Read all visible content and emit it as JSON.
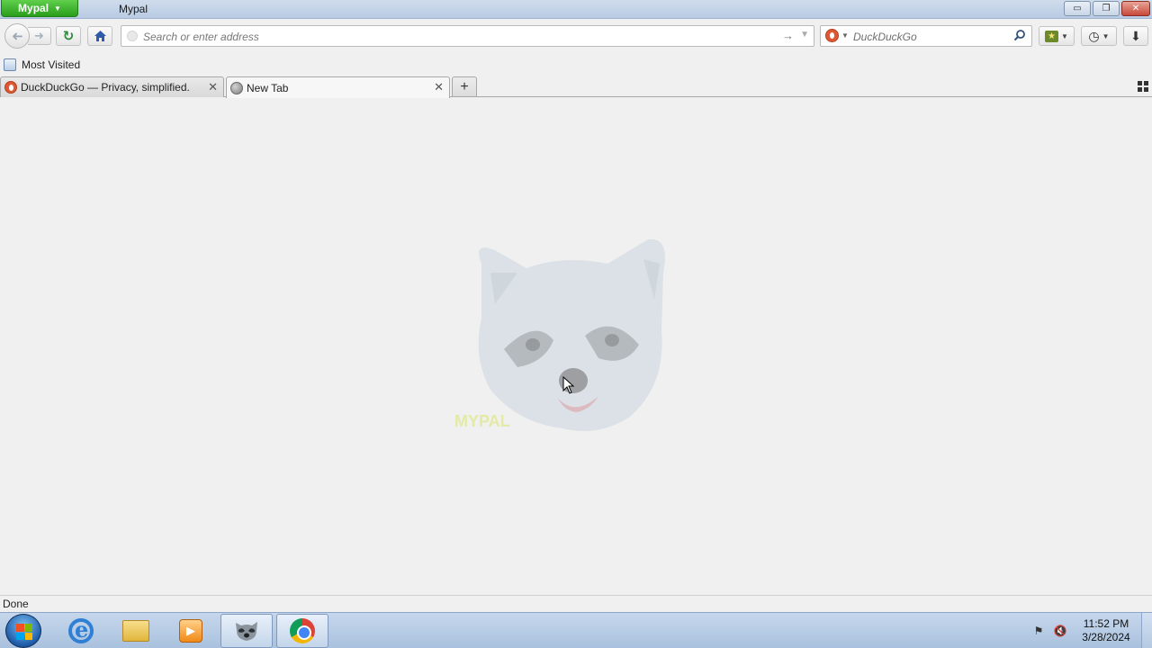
{
  "window": {
    "app_menu_label": "Mypal",
    "title": "Mypal",
    "controls": {
      "minimize": "▭",
      "restore": "❐",
      "close": "✕"
    }
  },
  "navbar": {
    "url_placeholder": "Search or enter address",
    "search_placeholder": "DuckDuckGo",
    "icons": {
      "back": "back-arrow-icon",
      "forward": "forward-arrow-icon",
      "reload": "reload-icon",
      "home": "home-icon",
      "go": "go-arrow-icon",
      "search": "magnifier-icon",
      "bookmarks": "bookmarks-icon",
      "history": "history-clock-icon",
      "downloads": "download-arrow-icon"
    }
  },
  "bookmarks_bar": {
    "items": [
      {
        "label": "Most Visited"
      }
    ]
  },
  "tabs": [
    {
      "title": "DuckDuckGo — Privacy, simplified.",
      "icon": "duckduckgo-icon",
      "active": false
    },
    {
      "title": "New Tab",
      "icon": "globe-icon",
      "active": true
    }
  ],
  "content": {
    "image": "raccoon-logo",
    "faded_text": "MYPAL"
  },
  "status": {
    "text": "Done"
  },
  "taskbar": {
    "items": [
      "internet-explorer",
      "file-explorer",
      "media-player",
      "mypal-browser",
      "chrome"
    ],
    "clock": {
      "time": "11:52 PM",
      "date": "3/28/2024"
    }
  },
  "colors": {
    "app_menu": "#2a9e1c",
    "titlebar": "#c3d4ea",
    "page_bg": "#f0f0f0",
    "taskbar": "#b4c9e3"
  }
}
